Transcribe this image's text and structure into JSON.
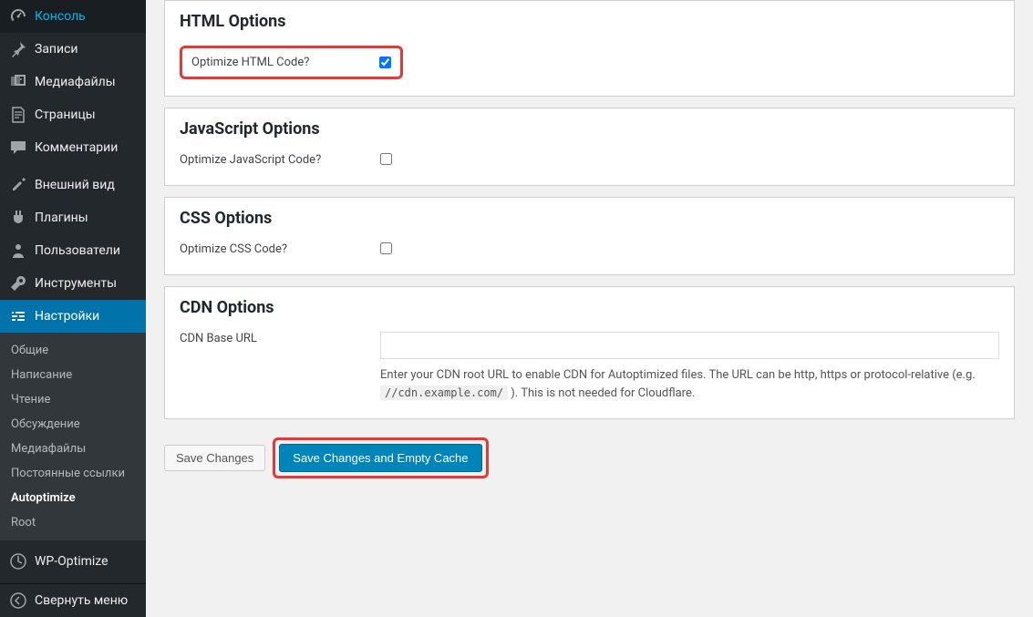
{
  "sidebar": {
    "main": [
      {
        "label": "Консоль",
        "icon": "dashboard"
      },
      {
        "label": "Записи",
        "icon": "pin"
      },
      {
        "label": "Медиафайлы",
        "icon": "media"
      },
      {
        "label": "Страницы",
        "icon": "pages"
      },
      {
        "label": "Комментарии",
        "icon": "comments"
      },
      {
        "label": "Внешний вид",
        "icon": "appearance"
      },
      {
        "label": "Плагины",
        "icon": "plugins"
      },
      {
        "label": "Пользователи",
        "icon": "users"
      },
      {
        "label": "Инструменты",
        "icon": "tools"
      },
      {
        "label": "Настройки",
        "icon": "settings",
        "active": true
      }
    ],
    "submenu": [
      {
        "label": "Общие"
      },
      {
        "label": "Написание"
      },
      {
        "label": "Чтение"
      },
      {
        "label": "Обсуждение"
      },
      {
        "label": "Медиафайлы"
      },
      {
        "label": "Постоянные ссылки"
      },
      {
        "label": "Autoptimize",
        "current": true
      },
      {
        "label": "Root"
      }
    ],
    "extra": [
      {
        "label": "WP-Optimize",
        "icon": "optimize"
      }
    ],
    "collapse": "Свернуть меню"
  },
  "sections": {
    "html": {
      "title": "HTML Options",
      "label": "Optimize HTML Code?",
      "checked": true
    },
    "js": {
      "title": "JavaScript Options",
      "label": "Optimize JavaScript Code?",
      "checked": false
    },
    "css": {
      "title": "CSS Options",
      "label": "Optimize CSS Code?",
      "checked": false
    },
    "cdn": {
      "title": "CDN Options",
      "label": "CDN Base URL",
      "value": "",
      "description_pre": "Enter your CDN root URL to enable CDN for Autoptimized files. The URL can be http, https or protocol-relative (e.g. ",
      "description_code": "//cdn.example.com/",
      "description_post": " ). This is not needed for Cloudflare."
    }
  },
  "buttons": {
    "save": "Save Changes",
    "save_empty": "Save Changes and Empty Cache"
  }
}
